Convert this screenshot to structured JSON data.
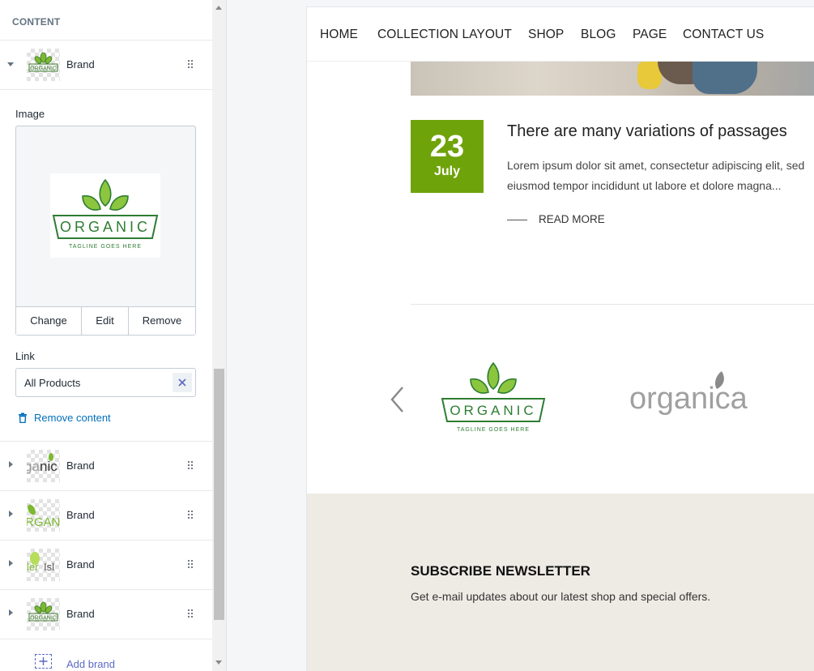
{
  "editor": {
    "section_title": "CONTENT",
    "expanded_brand": {
      "label": "Brand",
      "image_label": "Image",
      "actions": {
        "change": "Change",
        "edit": "Edit",
        "remove": "Remove"
      },
      "link_label": "Link",
      "link_value": "All Products",
      "remove_content": "Remove content"
    },
    "brands": [
      {
        "label": "Brand",
        "thumb": "organica-logo"
      },
      {
        "label": "Brand",
        "thumb": "organic-leaf-logo"
      },
      {
        "label": "Brand",
        "thumb": "green-leaf-logo"
      },
      {
        "label": "Brand",
        "thumb": "organic-logo"
      }
    ],
    "add_brand": "Add brand"
  },
  "preview": {
    "nav": [
      "HOME",
      "COLLECTION LAYOUT",
      "SHOP",
      "BLOG",
      "PAGE",
      "CONTACT US"
    ],
    "post": {
      "day": "23",
      "month": "July",
      "title": "There are many variations of passages",
      "excerpt_line1": "Lorem ipsum dolor sit amet, consectetur adipiscing elit, sed",
      "excerpt_line2": "eiusmod tempor incididunt ut labore et dolore magna...",
      "read_more": "READ MORE"
    },
    "logos": {
      "organic_main": "ORGANIC",
      "organic_tagline": "TAGLINE GOES HERE",
      "organica": "organica"
    },
    "newsletter": {
      "title": "SUBSCRIBE NEWSLETTER",
      "description": "Get e-mail updates about our latest shop and special offers."
    }
  },
  "colors": {
    "accent_green": "#6fa30a",
    "link_blue": "#006fbb",
    "add_purple": "#5c6ac4",
    "newsletter_bg": "#eeebe5"
  }
}
